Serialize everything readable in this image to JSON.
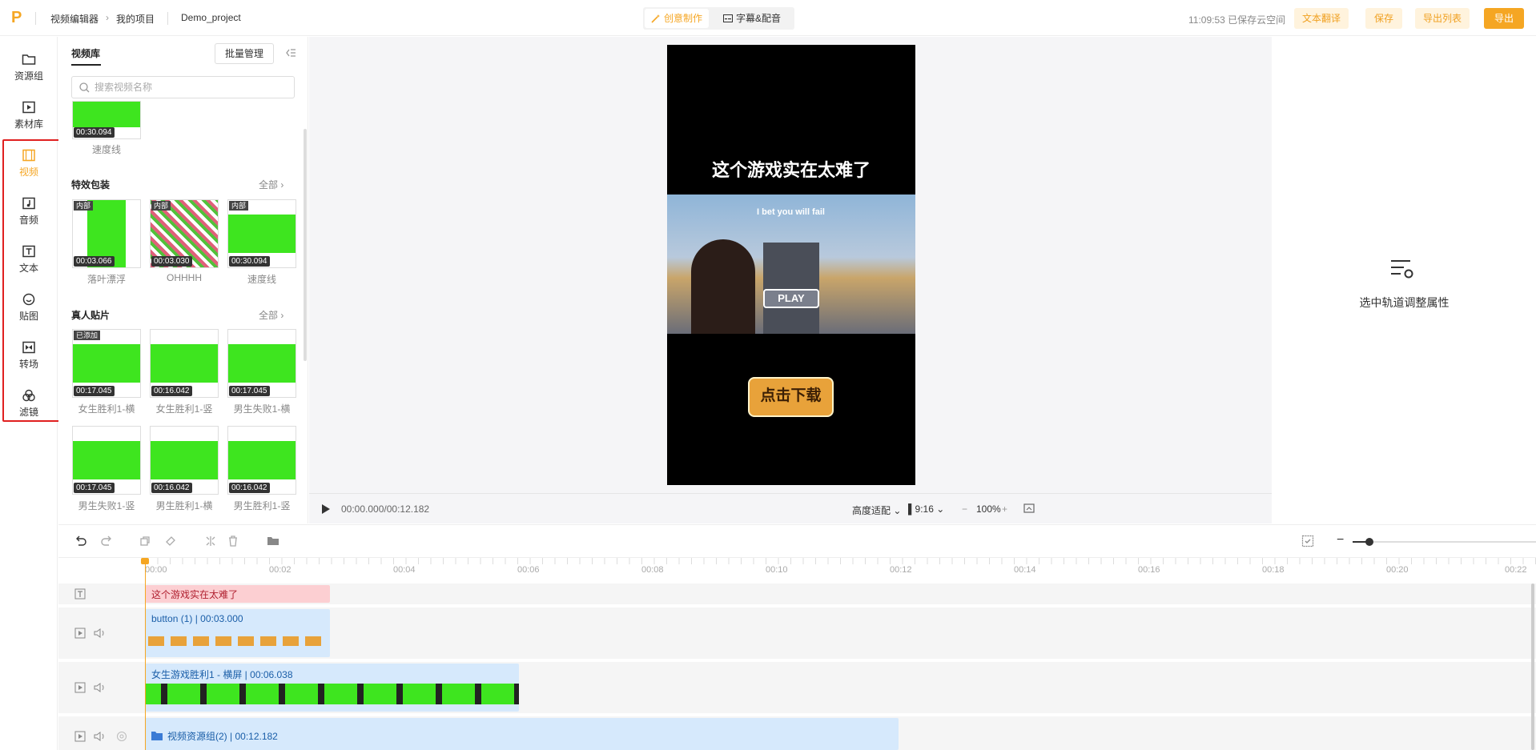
{
  "topbar": {
    "crumbs": [
      "视频编辑器",
      "我的项目",
      "Demo_project"
    ],
    "modes": [
      "创意制作",
      "字幕&配音"
    ],
    "save_status": "11:09:53 已保存云空间",
    "buttons": [
      "文本翻译",
      "保存",
      "导出列表",
      "导出"
    ]
  },
  "nav": {
    "items": [
      "资源组",
      "素材库",
      "视频",
      "音频",
      "文本",
      "贴图",
      "转场",
      "滤镜"
    ]
  },
  "panel": {
    "tab": "视频库",
    "bulk_button": "批量管理",
    "search_placeholder": "搜索视频名称",
    "first_clip": {
      "duration": "00:30.094",
      "name": "速度线"
    },
    "effects": {
      "title": "特效包装",
      "all": "全部",
      "items": [
        {
          "tag": "内部",
          "duration": "00:03.066",
          "name": "落叶漂浮"
        },
        {
          "tag": "内部",
          "duration": "00:03.030",
          "name": "OHHHH"
        },
        {
          "tag": "内部",
          "duration": "00:30.094",
          "name": "速度线"
        }
      ]
    },
    "people": {
      "title": "真人贴片",
      "all": "全部",
      "items": [
        {
          "tag": "已添加",
          "duration": "00:17.045",
          "name": "女生胜利1-横"
        },
        {
          "tag": "",
          "duration": "00:16.042",
          "name": "女生胜利1-竖"
        },
        {
          "tag": "",
          "duration": "00:17.045",
          "name": "男生失败1-横"
        },
        {
          "tag": "",
          "duration": "00:17.045",
          "name": "男生失败1-竖"
        },
        {
          "tag": "",
          "duration": "00:16.042",
          "name": "男生胜利1-横"
        },
        {
          "tag": "",
          "duration": "00:16.042",
          "name": "男生胜利1-竖"
        }
      ]
    }
  },
  "preview": {
    "headline": "这个游戏实在太难了",
    "game_caption": "I bet you will fail",
    "play_label": "PLAY",
    "download_label": "点击下载",
    "time": "00:00.000/00:12.182",
    "fit": "高度适配",
    "ratio": "9:16",
    "zoom": "100%"
  },
  "props": {
    "hint": "选中轨道调整属性"
  },
  "timeline": {
    "ticks": [
      "00:00",
      "00:02",
      "00:04",
      "00:06",
      "00:08",
      "00:10",
      "00:12",
      "00:14",
      "00:16",
      "00:18",
      "00:20",
      "00:22"
    ],
    "tracks": {
      "text_clip": "这个游戏实在太难了",
      "button_clip": {
        "name": "button (1)",
        "duration": "00:03.000"
      },
      "video_clip": {
        "name": "女生游戏胜利1 - 横屏",
        "duration": "00:06.038"
      },
      "group_clip": {
        "name": "视频资源组(2)",
        "duration": "00:12.182"
      }
    }
  },
  "colors": {
    "accent": "#f5a623",
    "green": "#3ee51f",
    "highlight": "#e02020"
  }
}
